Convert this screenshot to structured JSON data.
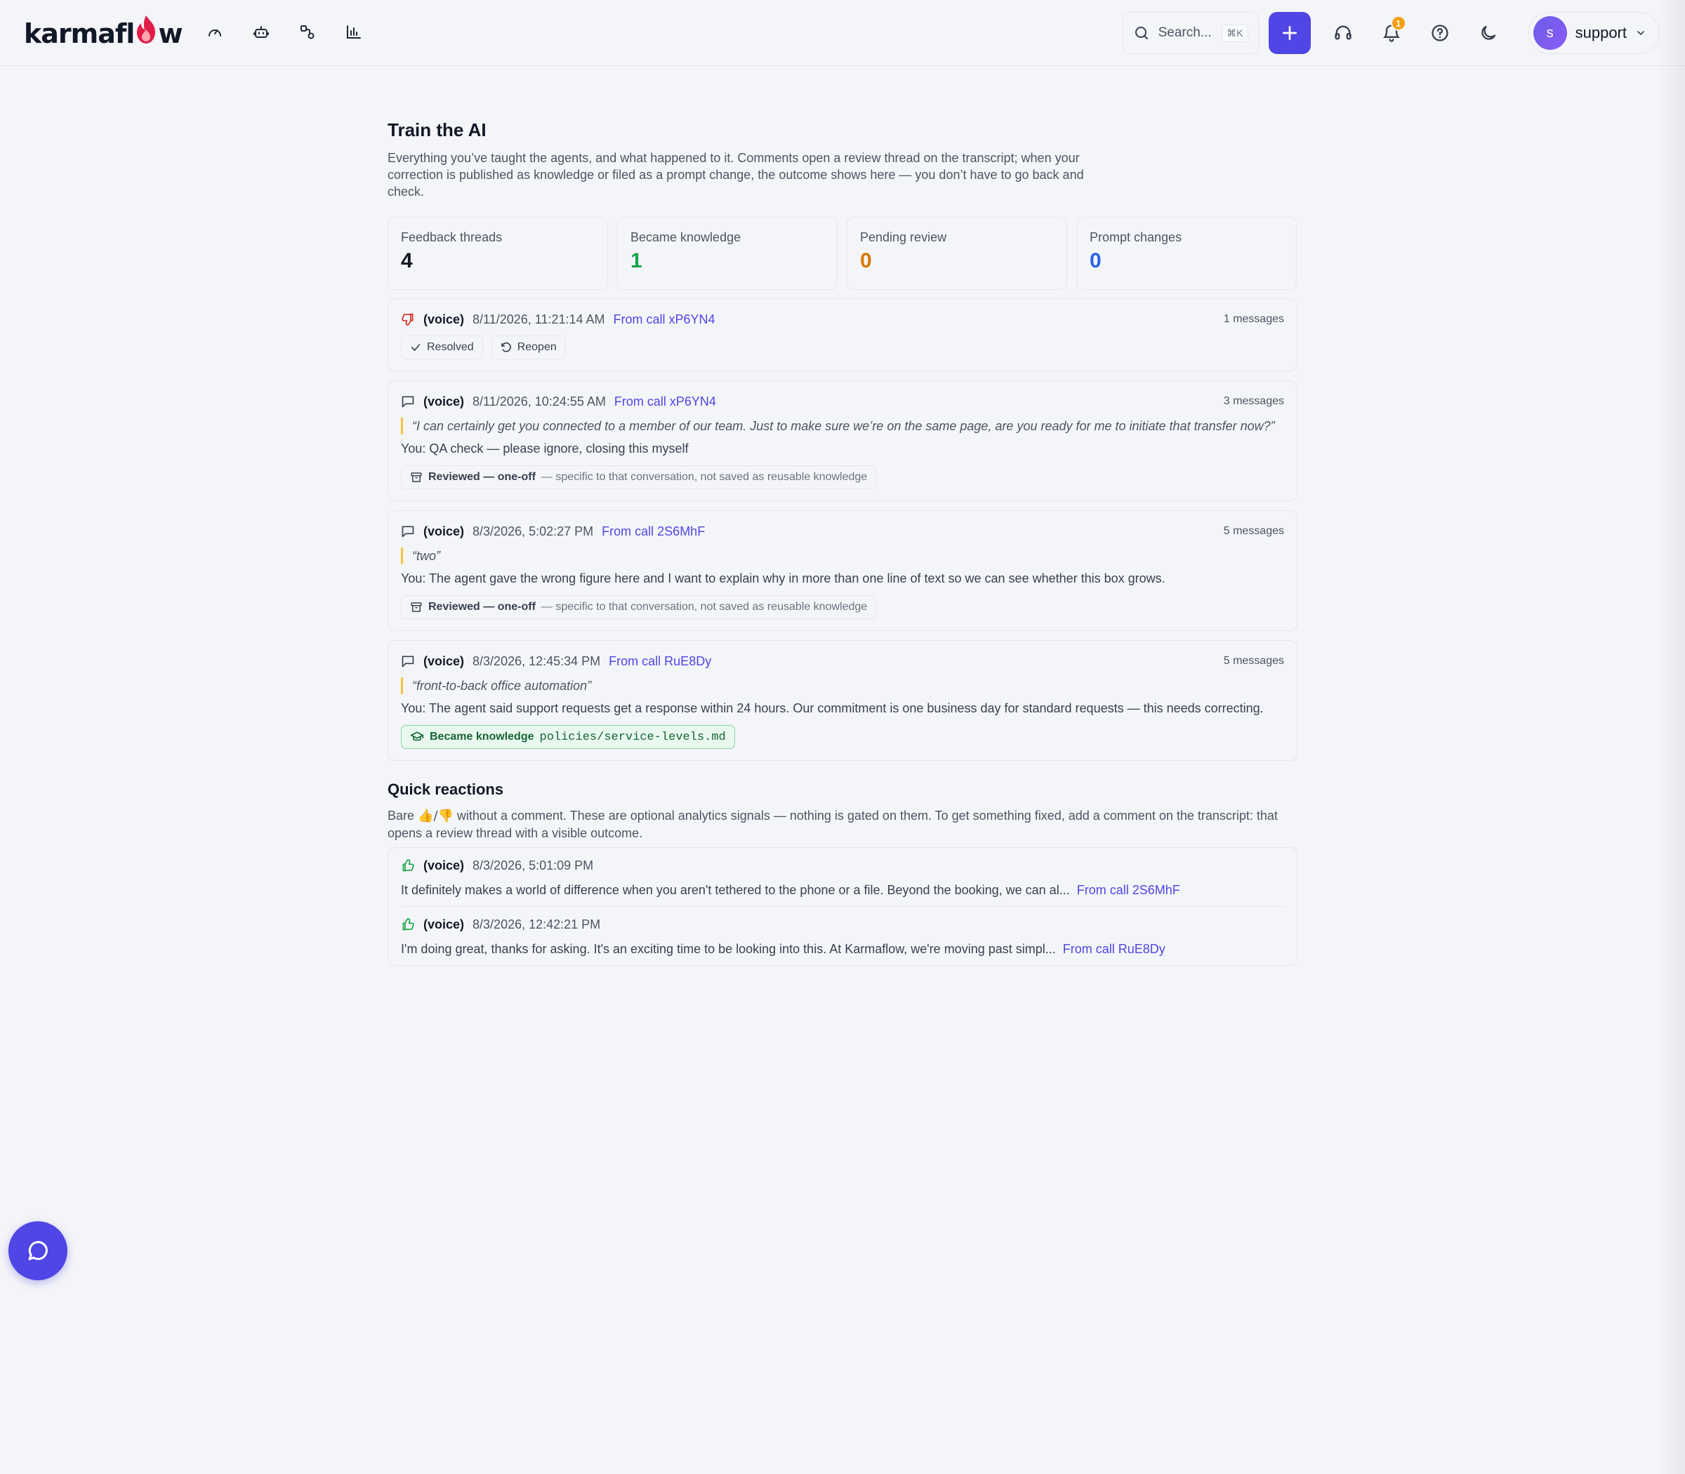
{
  "brand": {
    "name_part1": "karmafl",
    "name_part2": "w",
    "accent": "#4f46e5"
  },
  "nav": [
    {
      "name": "dashboard-icon",
      "label": "Dashboard"
    },
    {
      "name": "bot-icon",
      "label": "Agents"
    },
    {
      "name": "workflow-icon",
      "label": "Flows"
    },
    {
      "name": "analytics-icon",
      "label": "Analytics"
    }
  ],
  "toolbar": {
    "search_placeholder": "Search...",
    "search_shortcut": "⌘K",
    "notification_count": "1",
    "user_initial": "s",
    "user_name": "support"
  },
  "page": {
    "title": "Train the AI",
    "description": "Everything you’ve taught the agents, and what happened to it. Comments open a review thread on the transcript; when your correction is published as knowledge or filed as a prompt change, the outcome shows here — you don’t have to go back and check."
  },
  "stats": [
    {
      "label": "Feedback threads",
      "value": "4",
      "color": "#111827"
    },
    {
      "label": "Became knowledge",
      "value": "1",
      "color": "#16a34a"
    },
    {
      "label": "Pending review",
      "value": "0",
      "color": "#d97706"
    },
    {
      "label": "Prompt changes",
      "value": "0",
      "color": "#2563eb"
    }
  ],
  "threads": [
    {
      "icon": "thumbs-down-icon",
      "channel": "(voice)",
      "date": "8/11/2026, 11:21:14 AM",
      "link": "From call xP6YN4",
      "count": "1 messages",
      "actions": {
        "resolved": "Resolved",
        "reopen": "Reopen"
      }
    },
    {
      "icon": "comment-icon",
      "channel": "(voice)",
      "date": "8/11/2026, 10:24:55 AM",
      "link": "From call xP6YN4",
      "count": "3 messages",
      "quote": "“I can certainly get you connected to a member of our team. Just to make sure we’re on the same page, are you ready for me to initiate that transfer now?”",
      "comment": "You: QA check — please ignore, closing this myself",
      "outcome": {
        "label": "Reviewed — one-off",
        "detail": "— specific to that conversation, not saved as reusable knowledge"
      }
    },
    {
      "icon": "comment-icon",
      "channel": "(voice)",
      "date": "8/3/2026, 5:02:27 PM",
      "link": "From call 2S6MhF",
      "count": "5 messages",
      "quote": "“two”",
      "comment": "You: The agent gave the wrong figure here and I want to explain why in more than one line of text so we can see whether this box grows.",
      "outcome": {
        "label": "Reviewed — one-off",
        "detail": "— specific to that conversation, not saved as reusable knowledge"
      }
    },
    {
      "icon": "comment-icon",
      "channel": "(voice)",
      "date": "8/3/2026, 12:45:34 PM",
      "link": "From call RuE8Dy",
      "count": "5 messages",
      "quote": "“front-to-back office automation”",
      "comment": "You: The agent said support requests get a response within 24 hours. Our commitment is one business day for standard requests — this needs correcting.",
      "knowledge": {
        "label": "Became knowledge",
        "path": "policies/service-levels.md"
      }
    }
  ],
  "quick_reactions": {
    "title": "Quick reactions",
    "desc_before": "Bare ",
    "desc_emoji": "👍/👎",
    "desc_after": " without a comment. These are optional analytics signals — nothing is gated on them. To get something fixed, add a comment on the transcript: that opens a review thread with a visible outcome.",
    "items": [
      {
        "channel": "(voice)",
        "date": "8/3/2026, 5:01:09 PM",
        "text": "It definitely makes a world of difference when you aren't tethered to the phone or a file. Beyond the booking, we can al...",
        "link": "From call 2S6MhF"
      },
      {
        "channel": "(voice)",
        "date": "8/3/2026, 12:42:21 PM",
        "text": "I'm doing great, thanks for asking. It's an exciting time to be looking into this. At Karmaflow, we're moving past simpl...",
        "link": "From call RuE8Dy"
      }
    ]
  }
}
